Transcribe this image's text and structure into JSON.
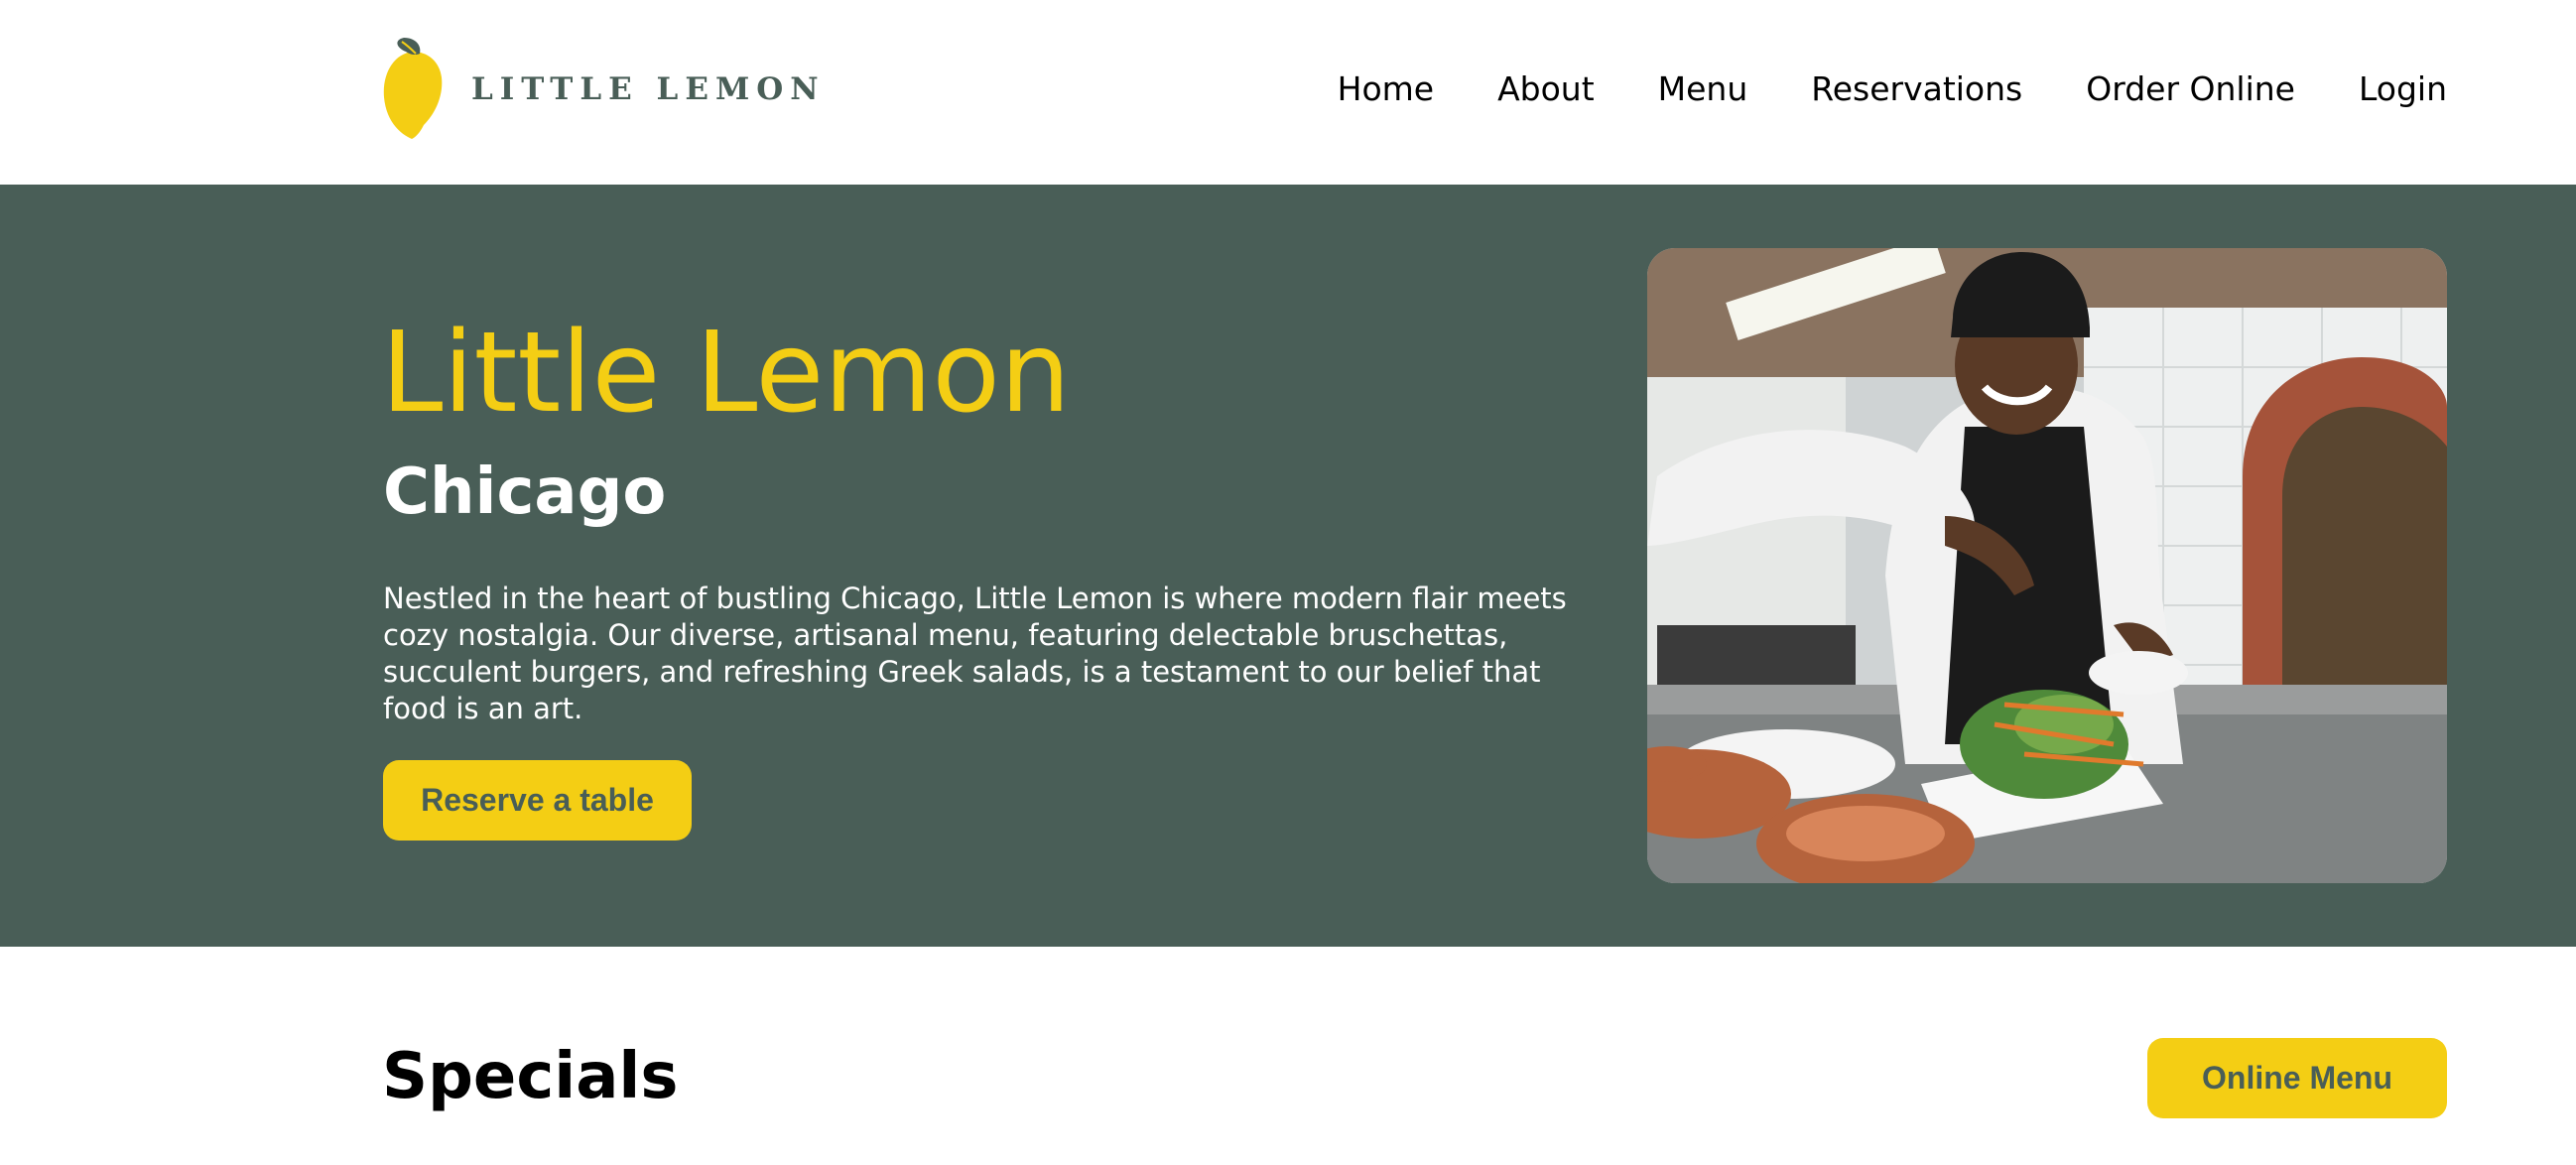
{
  "brand": {
    "logo_text": "LITTLE LEMON",
    "primary_color": "#495e57",
    "accent_color": "#f4ce14"
  },
  "nav": {
    "items": [
      {
        "label": "Home"
      },
      {
        "label": "About"
      },
      {
        "label": "Menu"
      },
      {
        "label": "Reservations"
      },
      {
        "label": "Order Online"
      },
      {
        "label": "Login"
      }
    ]
  },
  "hero": {
    "title": "Little Lemon",
    "subtitle": "Chicago",
    "description": "Nestled in the heart of bustling Chicago, Little Lemon is where modern flair meets cozy nostalgia. Our diverse, artisanal menu, featuring delectable bruschettas, succulent burgers, and refreshing Greek salads, is a testament to our belief that food is an art.",
    "cta_label": "Reserve a table",
    "photo_icon": "chef-plating-salad-photo"
  },
  "specials": {
    "title": "Specials",
    "button_label": "Online Menu"
  }
}
